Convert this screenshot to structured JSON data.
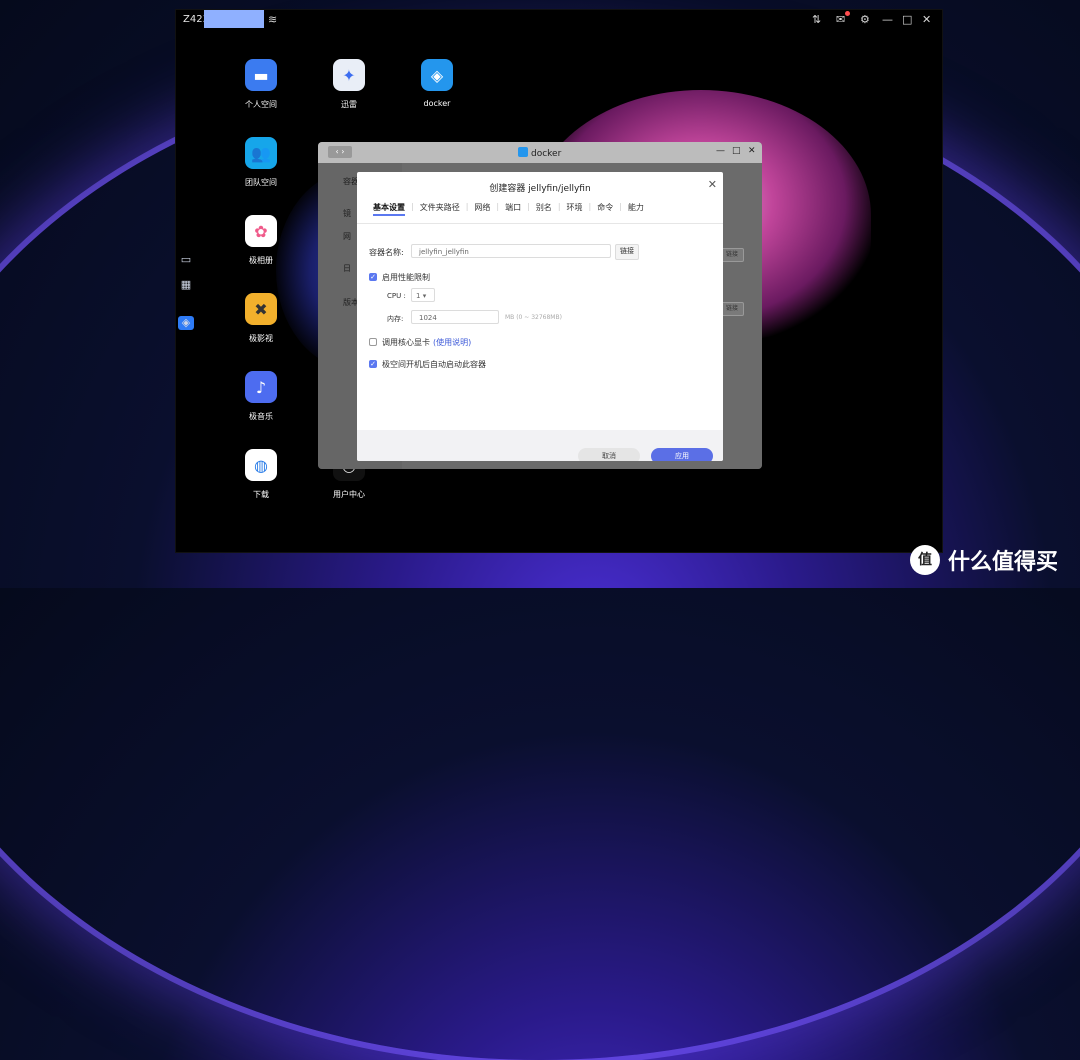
{
  "topbar": {
    "host": "Z423-",
    "icons": [
      "wifi-icon",
      "transfer-icon",
      "mail-icon",
      "gear-icon",
      "minimize-icon",
      "maximize-icon",
      "close-icon"
    ]
  },
  "desktop_apps": [
    {
      "label": "个人空间",
      "icon": "folder-icon",
      "color": "#3b7bf0"
    },
    {
      "label": "迅雷",
      "icon": "xunlei-bird-icon",
      "color": "#e9eef7"
    },
    {
      "label": "docker",
      "icon": "docker-whale-icon",
      "color": "#2496ed"
    },
    {
      "label": "团队空间",
      "icon": "team-folder-icon",
      "color": "#16a6ea"
    },
    {
      "label": "极相册",
      "icon": "photos-icon",
      "color": "#ffffff"
    },
    {
      "label": "极影视",
      "icon": "video-icon",
      "color": "#f2b02c"
    },
    {
      "label": "极音乐",
      "icon": "music-icon",
      "color": "#4d6cf0"
    },
    {
      "label": "下载",
      "icon": "download-globe-icon",
      "color": "#ffffff"
    },
    {
      "label": "用户中心",
      "icon": "user-icon",
      "color": "#111111"
    }
  ],
  "docker_window": {
    "title": "docker",
    "sidebar_items": [
      "容器",
      "镜",
      "网",
      "日",
      "版本"
    ],
    "row_buttons": [
      "链接",
      "链接"
    ]
  },
  "dialog": {
    "title": "创建容器 jellyfin/jellyfin",
    "tabs": [
      "基本设置",
      "文件夹路径",
      "网络",
      "端口",
      "别名",
      "环境",
      "命令",
      "能力"
    ],
    "active_tab": "基本设置",
    "container_name_label": "容器名称:",
    "container_name_value": "jellyfin_jellyfin",
    "link_button": "链接",
    "enable_limit_label": "启用性能限制",
    "enable_limit_checked": true,
    "cpu_label": "CPU :",
    "cpu_value": "1",
    "memory_label": "内存:",
    "memory_value": "1024",
    "memory_hint": "MB (0 ~ 32768MB)",
    "gpu_label": "调用核心显卡",
    "gpu_checked": false,
    "gpu_help_link": "(使用说明)",
    "autostart_label": "极空间开机后自动启动此容器",
    "autostart_checked": true,
    "cancel_button": "取消",
    "apply_button": "应用"
  },
  "watermark": {
    "logo": "值",
    "text": "什么值得买"
  },
  "colors": {
    "accent": "#5b6fe6",
    "docker_blue": "#2496ed",
    "badge_red": "#ff4d4f"
  }
}
